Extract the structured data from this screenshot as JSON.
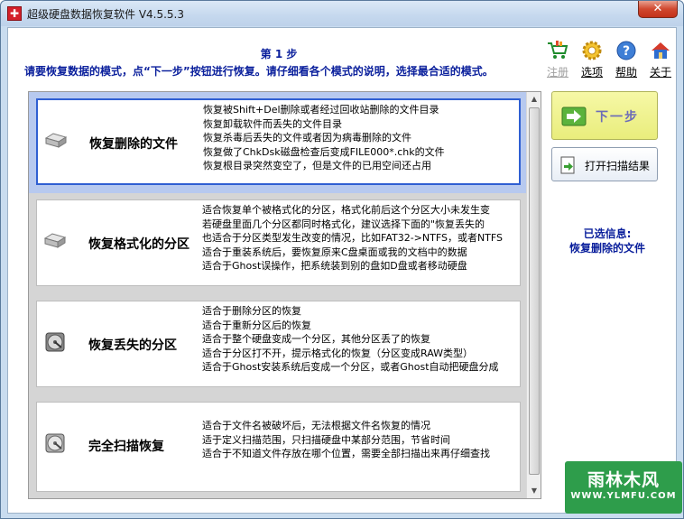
{
  "window": {
    "title": "超级硬盘数据恢复软件 V4.5.5.3",
    "close_label": "✕"
  },
  "header": {
    "step_title": "第 1 步",
    "instruction": "请要恢复数据的模式，点“下一步”按钮进行恢复。请仔细看各个模式的说明，选择最合适的模式。"
  },
  "toolbar": {
    "items": [
      {
        "label": "注册",
        "icon": "cart-icon",
        "enabled": false
      },
      {
        "label": "选项",
        "icon": "gear-icon",
        "enabled": true
      },
      {
        "label": "帮助",
        "icon": "help-icon",
        "enabled": true
      },
      {
        "label": "关于",
        "icon": "home-icon",
        "enabled": true
      }
    ]
  },
  "modes": [
    {
      "name": "恢复删除的文件",
      "selected": true,
      "icon": "hdd-icon",
      "lines": [
        "恢复被Shift+Del删除或者经过回收站删除的文件目录",
        "恢复卸载软件而丢失的文件目录",
        "恢复杀毒后丢失的文件或者因为病毒删除的文件",
        "恢复做了ChkDsk磁盘检查后变成FILE000*.chk的文件",
        "恢复根目录突然变空了，但是文件的已用空间还占用"
      ]
    },
    {
      "name": "恢复格式化的分区",
      "selected": false,
      "icon": "hdd-icon",
      "lines": [
        "适合恢复单个被格式化的分区，格式化前后这个分区大小未发生变",
        "若硬盘里面几个分区都同时格式化，建议选择下面的\"恢复丢失的",
        "也适合于分区类型发生改变的情况，比如FAT32->NTFS，或者NTFS",
        "适合于重装系统后，要恢复原来C盘桌面或我的文档中的数据",
        "适合于Ghost误操作，把系统装到别的盘如D盘或者移动硬盘"
      ]
    },
    {
      "name": "恢复丢失的分区",
      "selected": false,
      "icon": "disk-platter-icon",
      "lines": [
        "适合于删除分区的恢复",
        "适合于重新分区后的恢复",
        "适合于整个硬盘变成一个分区，其他分区丢了的恢复",
        "适合于分区打不开，提示格式化的恢复（分区变成RAW类型）",
        "适合于Ghost安装系统后变成一个分区，或者Ghost自动把硬盘分成"
      ]
    },
    {
      "name": "完全扫描恢复",
      "selected": false,
      "icon": "disk-platter-icon",
      "lines": [
        "适合于文件名被破坏后，无法根据文件名恢复的情况",
        "适于定义扫描范围，只扫描硬盘中某部分范围，节省时间",
        "适合于不知道文件存放在哪个位置，需要全部扫描出来再仔细查找"
      ]
    }
  ],
  "buttons": {
    "next_label": "下一步",
    "open_scan_label": "打开扫描结果"
  },
  "selection_info": {
    "label": "已选信息:",
    "value": "恢复删除的文件"
  },
  "watermark": {
    "big": "雨林木风",
    "small": "WWW.YLMFU.COM"
  }
}
